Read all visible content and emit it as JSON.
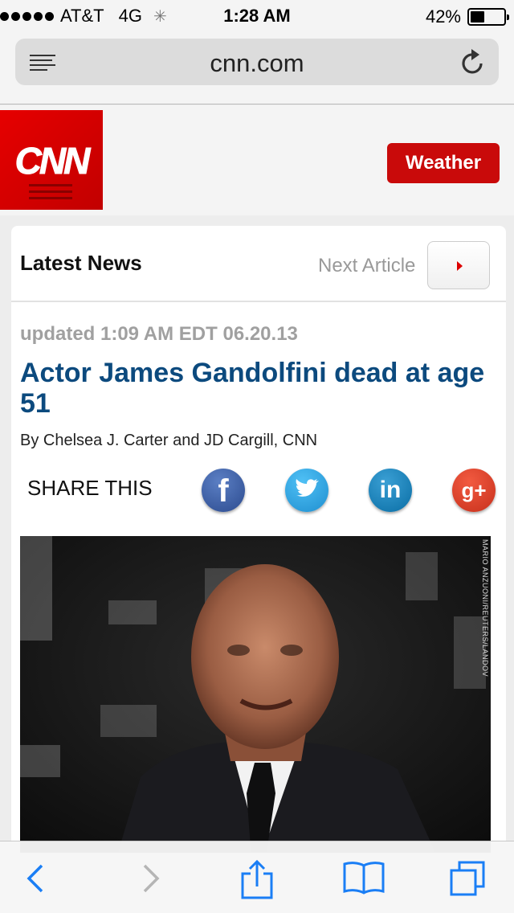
{
  "status_bar": {
    "carrier": "AT&T",
    "network": "4G",
    "time": "1:28 AM",
    "battery_percent_label": "42%",
    "battery_level": 0.42
  },
  "browser": {
    "url": "cnn.com"
  },
  "site": {
    "logo_text": "CNN",
    "weather_label": "Weather"
  },
  "article_nav": {
    "section_title": "Latest News",
    "next_label": "Next Article"
  },
  "article": {
    "updated": "updated 1:09 AM EDT 06.20.13",
    "headline": "Actor James Gandolfini dead at age 51",
    "byline": "By Chelsea J. Carter and JD Cargill, CNN",
    "share_label": "SHARE THIS",
    "photo_credit": "MARIO ANZUONI/REUTERS/LANDOV"
  },
  "share_buttons": [
    {
      "name": "facebook",
      "glyph": "f"
    },
    {
      "name": "twitter",
      "glyph": ""
    },
    {
      "name": "linkedin",
      "glyph": "in"
    },
    {
      "name": "google-plus",
      "glyph": "g+"
    }
  ],
  "colors": {
    "cnn_red": "#c90a0a",
    "headline_blue": "#0c4a7e",
    "ios_blue": "#1a7ef5"
  },
  "icons": {
    "reader": "reader-icon",
    "reload": "reload-icon",
    "back": "back-icon",
    "forward": "forward-icon",
    "share": "share-icon",
    "bookmarks": "bookmarks-icon",
    "tabs": "tabs-icon"
  }
}
